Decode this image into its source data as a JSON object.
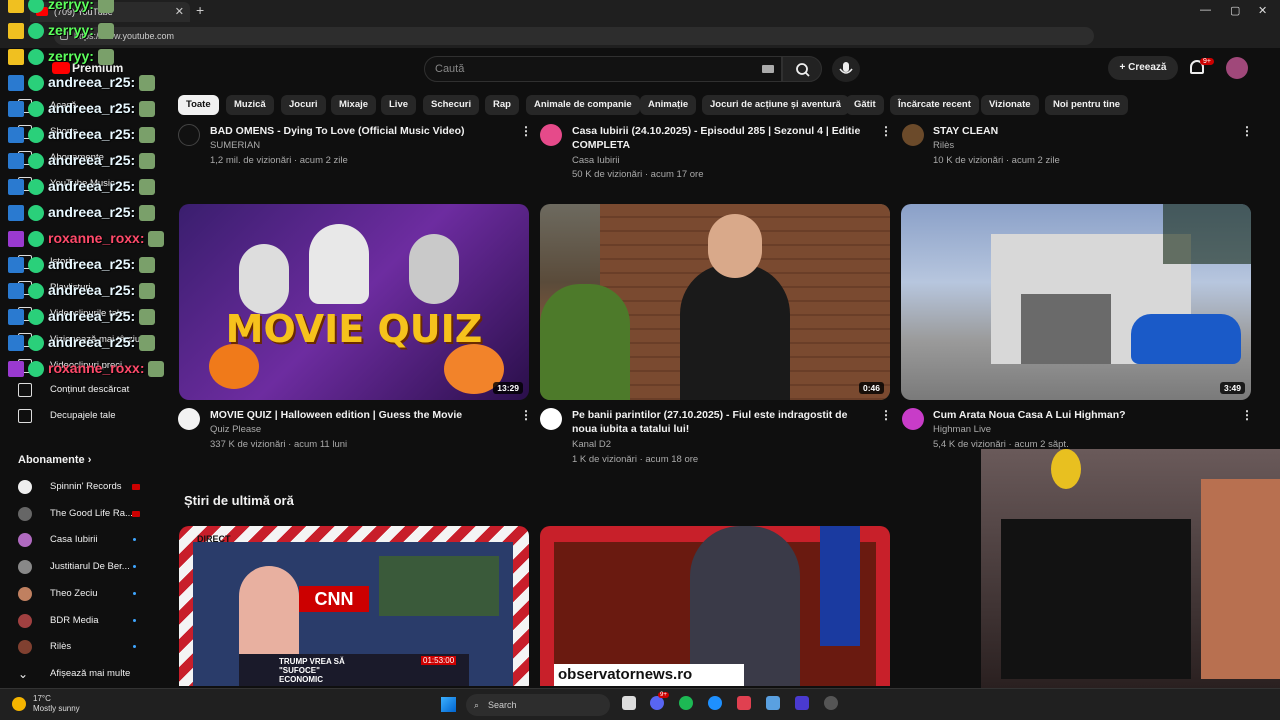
{
  "browser": {
    "tab_title": "(709) YouTube",
    "new_tab": "+",
    "url": "https://www.youtube.com",
    "win_controls": [
      "—",
      "▢",
      "✕"
    ]
  },
  "header": {
    "search_placeholder": "Caută",
    "create_label": "Creează",
    "notif_count": "9+",
    "premium_label": "Premium"
  },
  "chips": [
    "Toate",
    "Muzică",
    "Jocuri",
    "Mixaje",
    "Live",
    "Schecuri",
    "Rap",
    "Animale de companie",
    "Animație",
    "Jocuri de acțiune și aventură",
    "Gătit",
    "Încărcate recent",
    "Vizionate",
    "Noi pentru tine"
  ],
  "sidebar": {
    "items": [
      {
        "label": "Acasă",
        "icon": "home-icon"
      },
      {
        "label": "Shorts",
        "icon": "shorts-icon"
      },
      {
        "label": "Abonamente",
        "icon": "subscriptions-icon"
      },
      {
        "label": "YouTube Music",
        "icon": "music-icon"
      },
      {
        "label": "Istoric",
        "icon": "history-icon"
      },
      {
        "label": "Playlisturi",
        "icon": "playlist-icon"
      },
      {
        "label": "Videoclipurile tale",
        "icon": "your-videos-icon"
      },
      {
        "label": "Vizionează mai târziu",
        "icon": "watch-later-icon"
      },
      {
        "label": "Videoclipuri preci",
        "icon": "liked-icon"
      },
      {
        "label": "Conținut descărcat",
        "icon": "download-icon"
      },
      {
        "label": "Decupajele tale",
        "icon": "scissors-icon"
      }
    ],
    "subs_heading": "Abonamente",
    "subs": [
      {
        "name": "Spinnin' Records",
        "live": true
      },
      {
        "name": "The Good Life Ra...",
        "live": true
      },
      {
        "name": "Casa Iubirii",
        "live": false
      },
      {
        "name": "Justitiarul De Ber...",
        "live": false
      },
      {
        "name": "Theo Zeciu",
        "live": false
      },
      {
        "name": "BDR Media",
        "live": false
      },
      {
        "name": "Rilès",
        "live": false
      }
    ],
    "show_more": "Afișează mai multe"
  },
  "chat": [
    {
      "user": "zerryy:",
      "color": "#5cff5c"
    },
    {
      "user": "zerryy:",
      "color": "#5cff5c"
    },
    {
      "user": "zerryy:",
      "color": "#5cff5c"
    },
    {
      "user": "andreea_r25:",
      "color": "#e8f8ff"
    },
    {
      "user": "andreea_r25:",
      "color": "#e8f8ff"
    },
    {
      "user": "andreea_r25:",
      "color": "#e8f8ff"
    },
    {
      "user": "andreea_r25:",
      "color": "#e8f8ff"
    },
    {
      "user": "andreea_r25:",
      "color": "#e8f8ff"
    },
    {
      "user": "andreea_r25:",
      "color": "#e8f8ff"
    },
    {
      "user": "roxanne_roxx:",
      "color": "#ff4a6a"
    },
    {
      "user": "andreea_r25:",
      "color": "#e8f8ff"
    },
    {
      "user": "andreea_r25:",
      "color": "#e8f8ff"
    },
    {
      "user": "andreea_r25:",
      "color": "#e8f8ff"
    },
    {
      "user": "andreea_r25:",
      "color": "#e8f8ff"
    },
    {
      "user": "roxanne_roxx:",
      "color": "#ff4a6a"
    }
  ],
  "videos_row1": [
    {
      "title": "BAD OMENS - Dying To Love (Official Music Video)",
      "channel": "SUMERIAN",
      "meta": "1,2 mil. de vizionări · acum 2 zile"
    },
    {
      "title": "Casa Iubirii (24.10.2025) - Episodul 285 | Sezonul 4 | Editie COMPLETA",
      "channel": "Casa Iubirii",
      "meta": "50 K de vizionări · acum 17 ore"
    },
    {
      "title": "STAY CLEAN",
      "channel": "Rilès",
      "meta": "10 K de vizionări · acum 2 zile"
    }
  ],
  "videos_row2": [
    {
      "title": "MOVIE QUIZ | Halloween edition | Guess the Movie",
      "channel": "Quiz Please",
      "meta": "337 K de vizionări · acum 11 luni",
      "duration": "13:29",
      "thumb_text": "MOVIE QUIZ"
    },
    {
      "title": "Pe banii parintilor (27.10.2025) - Fiul este indragostit de noua iubita a tatalui lui!",
      "channel": "Kanal D2",
      "meta": "1 K de vizionări · acum 18 ore",
      "duration": "0:46"
    },
    {
      "title": "Cum Arata Noua Casa A Lui Highman?",
      "channel": "Highman Live",
      "meta": "5,4 K de vizionări · acum 2 săpt.",
      "duration": "3:49"
    }
  ],
  "news": {
    "heading": "Știri de ultimă oră",
    "card1_tag": "DIRECT",
    "card1_headline": "TRUMP VREA SĂ \"SUFOCE\" ECONOMIC",
    "card1_time": "01:53:00",
    "card1_logo": "CNN",
    "card2_caption": "observatornews.ro"
  },
  "taskbar": {
    "weather_temp": "17°C",
    "weather_desc": "Mostly sunny",
    "search_label": "Search",
    "discord_badge": "9+"
  }
}
